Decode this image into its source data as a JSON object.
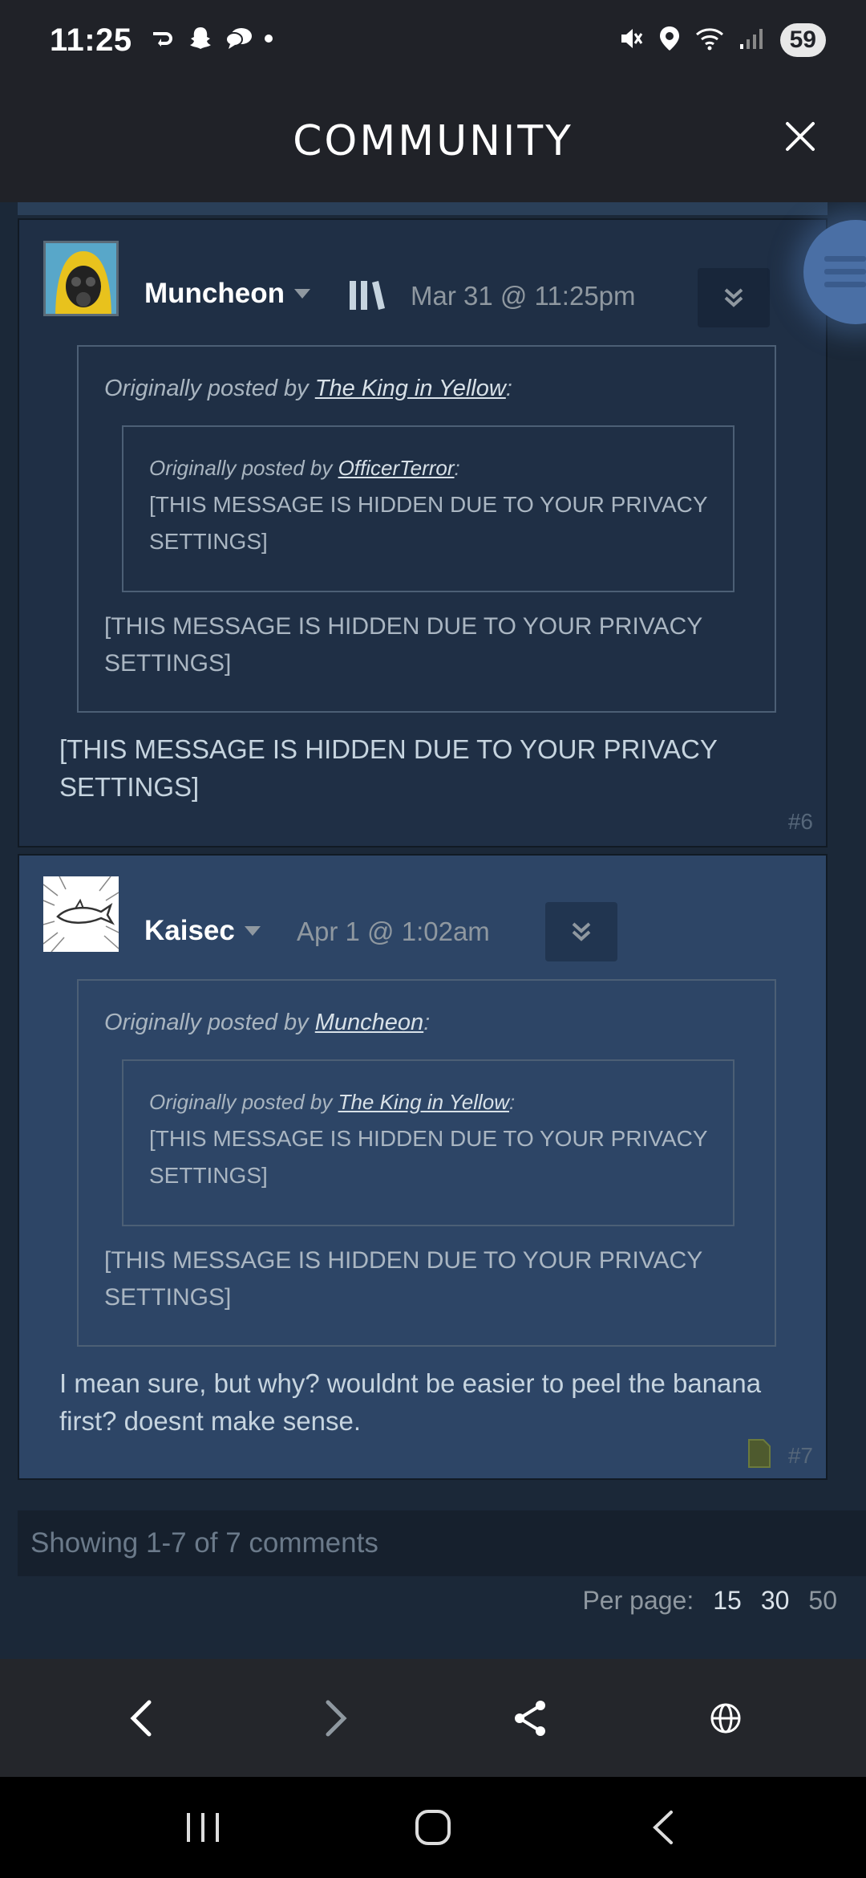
{
  "status_bar": {
    "time": "11:25",
    "battery": "59"
  },
  "header": {
    "title": "COMMUNITY"
  },
  "comments": [
    {
      "author": "Muncheon",
      "date": "Mar 31 @ 11:25pm",
      "quote_prefix": "Originally posted by ",
      "quote_author": "The King in Yellow",
      "quote_suffix": ":",
      "inner_quote_author": "OfficerTerror",
      "inner_quote_text": "[THIS MESSAGE IS HIDDEN DUE TO YOUR PRIVACY SETTINGS]",
      "outer_quote_text": "[THIS MESSAGE IS HIDDEN DUE TO YOUR PRIVACY SETTINGS]",
      "body": "[THIS MESSAGE IS HIDDEN DUE TO YOUR PRIVACY SETTINGS]",
      "number": "#6"
    },
    {
      "author": "Kaisec",
      "date": "Apr 1 @ 1:02am",
      "quote_prefix": "Originally posted by ",
      "quote_author": "Muncheon",
      "quote_suffix": ":",
      "inner_quote_author": "The King in Yellow",
      "inner_quote_text": "[THIS MESSAGE IS HIDDEN DUE TO YOUR PRIVACY SETTINGS]",
      "outer_quote_text": "[THIS MESSAGE IS HIDDEN DUE TO YOUR PRIVACY SETTINGS]",
      "body": "I mean sure, but why? wouldnt be easier to peel the banana first? doesnt make sense.",
      "number": "#7"
    }
  ],
  "pagination": {
    "summary": "Showing 1-7 of 7 comments",
    "per_page_label": "Per page:",
    "options": [
      "15",
      "30",
      "50"
    ]
  },
  "colors": {
    "background": "#1b2838",
    "comment_dark": "#1f2f45",
    "comment_highlight": "#2d4566",
    "text_light": "#c6d4df",
    "muted": "#8f98a0"
  }
}
